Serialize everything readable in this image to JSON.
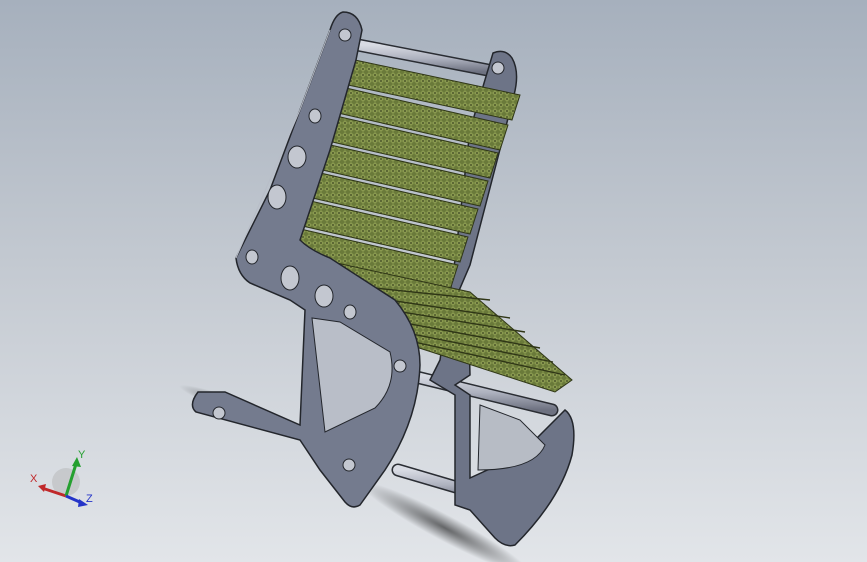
{
  "viewport": {
    "background_top": "#a6b0bd",
    "background_bottom": "#e2e5e9"
  },
  "model": {
    "name": "rocking chair",
    "frame_color": "#747b8e",
    "frame_edge_color": "#23262c",
    "rod_color": "#aeb2bf",
    "slat_color": "#6a7a3a",
    "slat_edge_color": "#2f3616"
  },
  "triad": {
    "x_label": "X",
    "y_label": "Y",
    "z_label": "Z",
    "x_color": "#c0282a",
    "y_color": "#25a030",
    "z_color": "#2434c8"
  }
}
